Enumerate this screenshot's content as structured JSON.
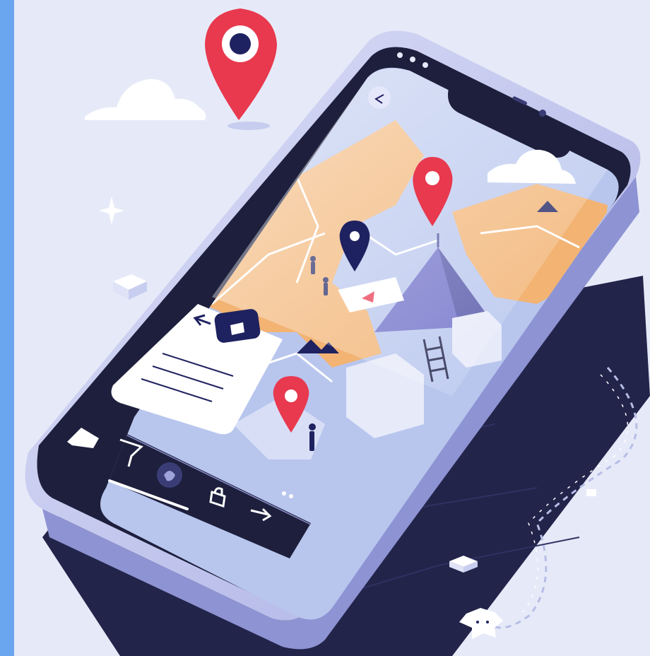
{
  "illustration": {
    "theme": "navigation map app on smartphone",
    "colors": {
      "background": "#e6eaf8",
      "left_strip": "#6aa5f0",
      "pin_red": "#e8394f",
      "pin_navy": "#1f2260",
      "land_orange": "#f2b373",
      "water_blue": "#b8c6ee",
      "phone_frame": "#1d1f3c",
      "phone_body": "#c9cdef",
      "mountain": "#6f70c9",
      "mat_dark": "#22244a"
    },
    "icons": {
      "back": "arrow-left-icon",
      "camera": "camera-icon",
      "play": "play-icon",
      "home": "home-icon",
      "filter": "filter-icon",
      "apple": "apple-icon",
      "lock": "lock-icon",
      "next": "arrow-right-icon"
    }
  }
}
